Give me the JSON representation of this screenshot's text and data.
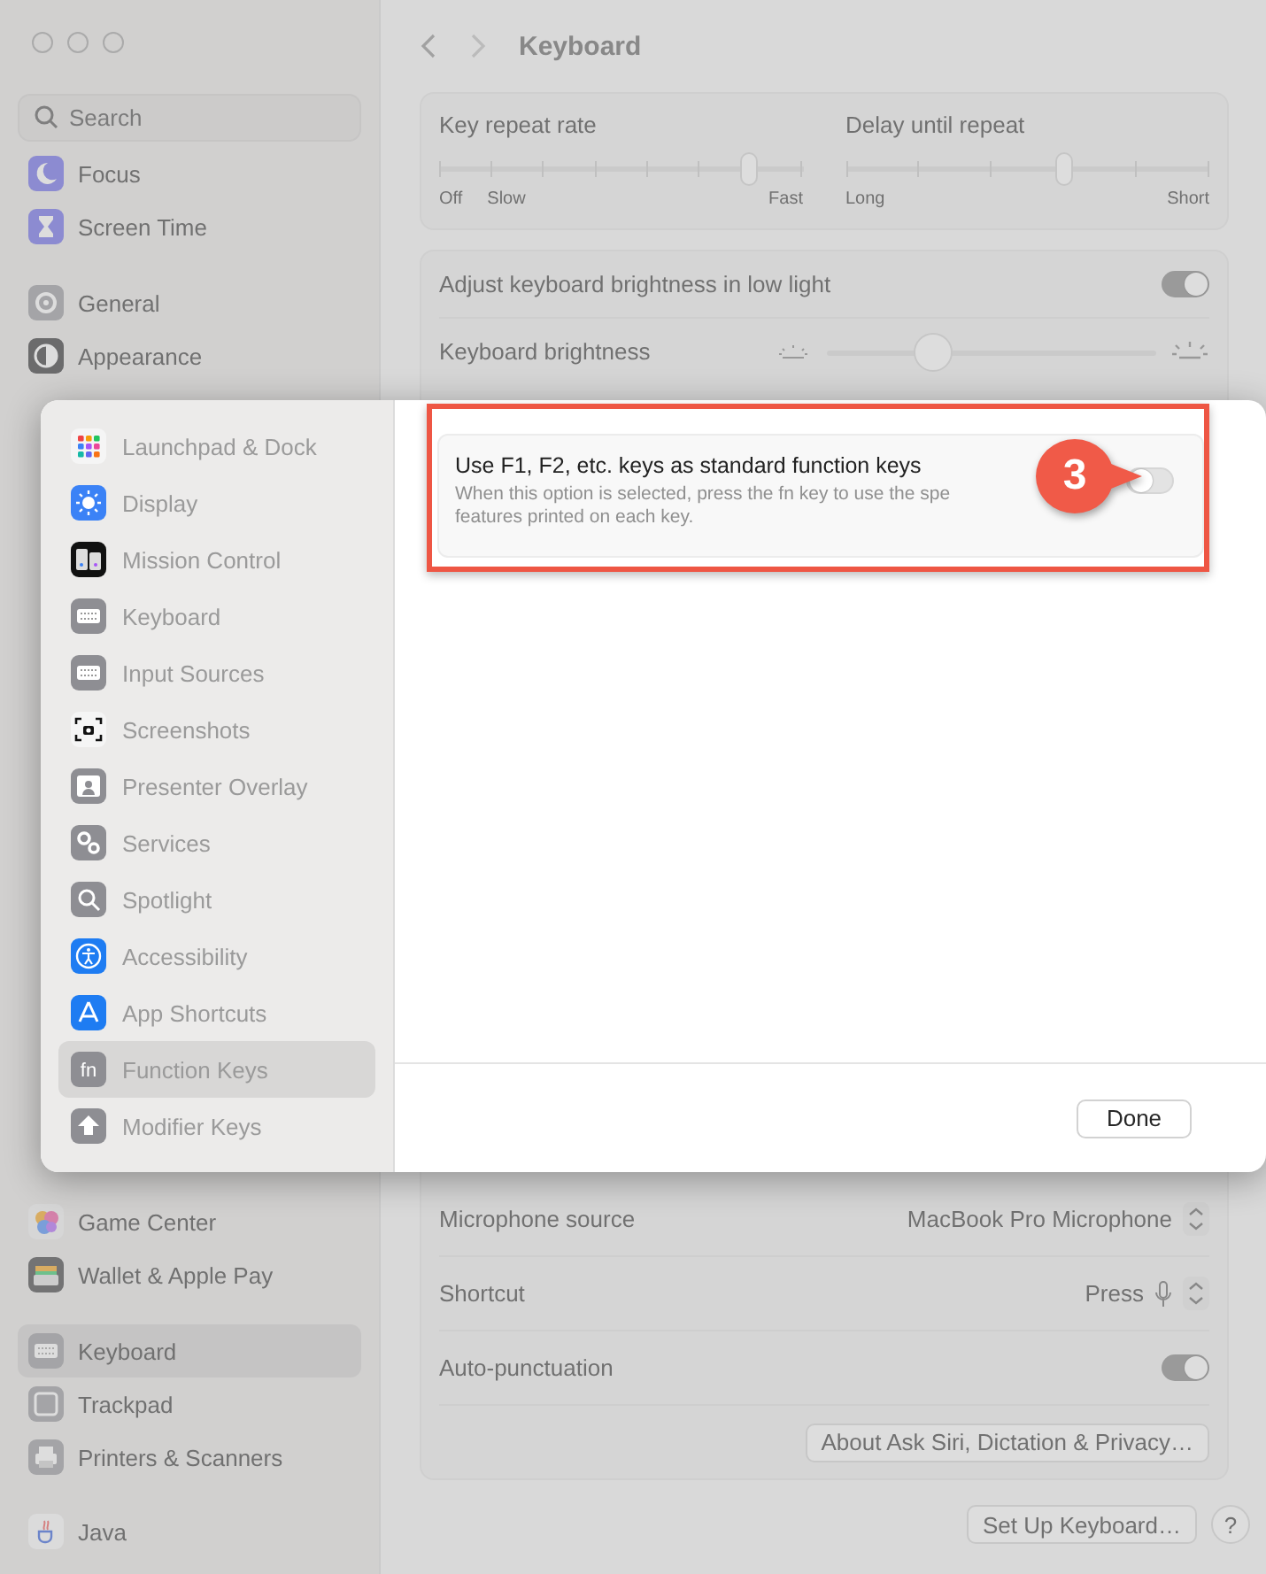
{
  "window": {
    "title": "Keyboard"
  },
  "sidebar": {
    "search": {
      "placeholder": "Search"
    },
    "sections": [
      {
        "items": [
          {
            "label": "Focus",
            "selected": false
          },
          {
            "label": "Screen Time",
            "selected": false
          }
        ]
      },
      {
        "items": [
          {
            "label": "General",
            "selected": false
          },
          {
            "label": "Appearance",
            "selected": false
          }
        ]
      },
      {
        "items": [
          {
            "label": "Game Center",
            "selected": false
          },
          {
            "label": "Wallet & Apple Pay",
            "selected": false
          }
        ]
      },
      {
        "items": [
          {
            "label": "Keyboard",
            "selected": true
          },
          {
            "label": "Trackpad",
            "selected": false
          },
          {
            "label": "Printers & Scanners",
            "selected": false
          }
        ]
      },
      {
        "items": [
          {
            "label": "Java",
            "selected": false
          }
        ]
      }
    ]
  },
  "repeat_card": {
    "sliders": [
      {
        "label": "Key repeat rate",
        "level": 0.85,
        "labels": [
          "Off",
          "Slow",
          "Fast"
        ]
      },
      {
        "label": "Delay until repeat",
        "level": 0.6,
        "labels": [
          "Long",
          "Short"
        ]
      }
    ]
  },
  "brightness_card": {
    "auto_adjust": {
      "label": "Adjust keyboard brightness in low light",
      "on": true
    },
    "brightness": {
      "label": "Keyboard brightness",
      "level": 0.3
    }
  },
  "dictation_card": {
    "rows": [
      {
        "kind": "popup",
        "label": "Microphone source",
        "value": "MacBook Pro Microphone"
      },
      {
        "kind": "shortcut",
        "label": "Shortcut",
        "value": "Press"
      },
      {
        "kind": "toggle",
        "label": "Auto-punctuation",
        "on": true
      },
      {
        "kind": "button",
        "label": "About Ask Siri, Dictation & Privacy…"
      }
    ]
  },
  "footer": {
    "setup_button": "Set Up Keyboard…",
    "help_button": "?"
  },
  "sheet": {
    "sidebar": {
      "items": [
        {
          "label": "Launchpad & Dock",
          "selected": false
        },
        {
          "label": "Display",
          "selected": false
        },
        {
          "label": "Mission Control",
          "selected": false
        },
        {
          "label": "Keyboard",
          "selected": false
        },
        {
          "label": "Input Sources",
          "selected": false
        },
        {
          "label": "Screenshots",
          "selected": false
        },
        {
          "label": "Presenter Overlay",
          "selected": false
        },
        {
          "label": "Services",
          "selected": false
        },
        {
          "label": "Spotlight",
          "selected": false
        },
        {
          "label": "Accessibility",
          "selected": false
        },
        {
          "label": "App Shortcuts",
          "selected": false
        },
        {
          "label": "Function Keys",
          "icon_text": "fn",
          "selected": true
        },
        {
          "label": "Modifier Keys",
          "selected": false
        }
      ]
    },
    "option": {
      "title": "Use F1, F2, etc. keys as standard function keys",
      "description_lines": [
        "When this option is selected, press the fn key to use the spe",
        "features printed on each key."
      ],
      "on": false
    },
    "annotation": {
      "number": "3"
    },
    "done_button": "Done"
  }
}
